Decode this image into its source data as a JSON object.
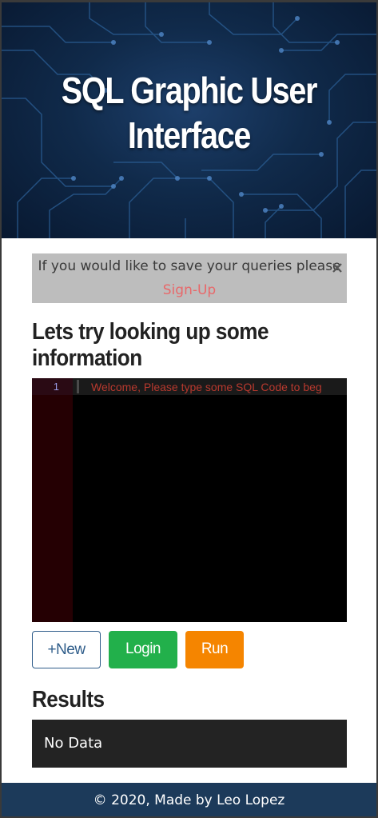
{
  "hero": {
    "title_line1": "SQL Graphic User",
    "title_line2": "Interface"
  },
  "alert": {
    "text_before": "If you would like to save your queries please ",
    "link_label": "Sign-Up",
    "close_icon": "close-icon"
  },
  "main": {
    "subheading": "Lets try looking up some information"
  },
  "editor": {
    "line_number": "1",
    "code_text": "Welcome, Please type some SQL Code to beg"
  },
  "buttons": {
    "new_label": "+New",
    "login_label": "Login",
    "run_label": "Run"
  },
  "results": {
    "title": "Results",
    "value": "No Data"
  },
  "footer": {
    "text": "© 2020, Made by Leo Lopez"
  },
  "colors": {
    "hero_bg": "#102a4a",
    "alert_bg": "#bdbdbd",
    "link": "#e8686a",
    "login": "#22b04b",
    "run": "#f58500",
    "new_border": "#2f5d8a",
    "results_bg": "#232323",
    "footer_bg": "#1c3a5a"
  }
}
